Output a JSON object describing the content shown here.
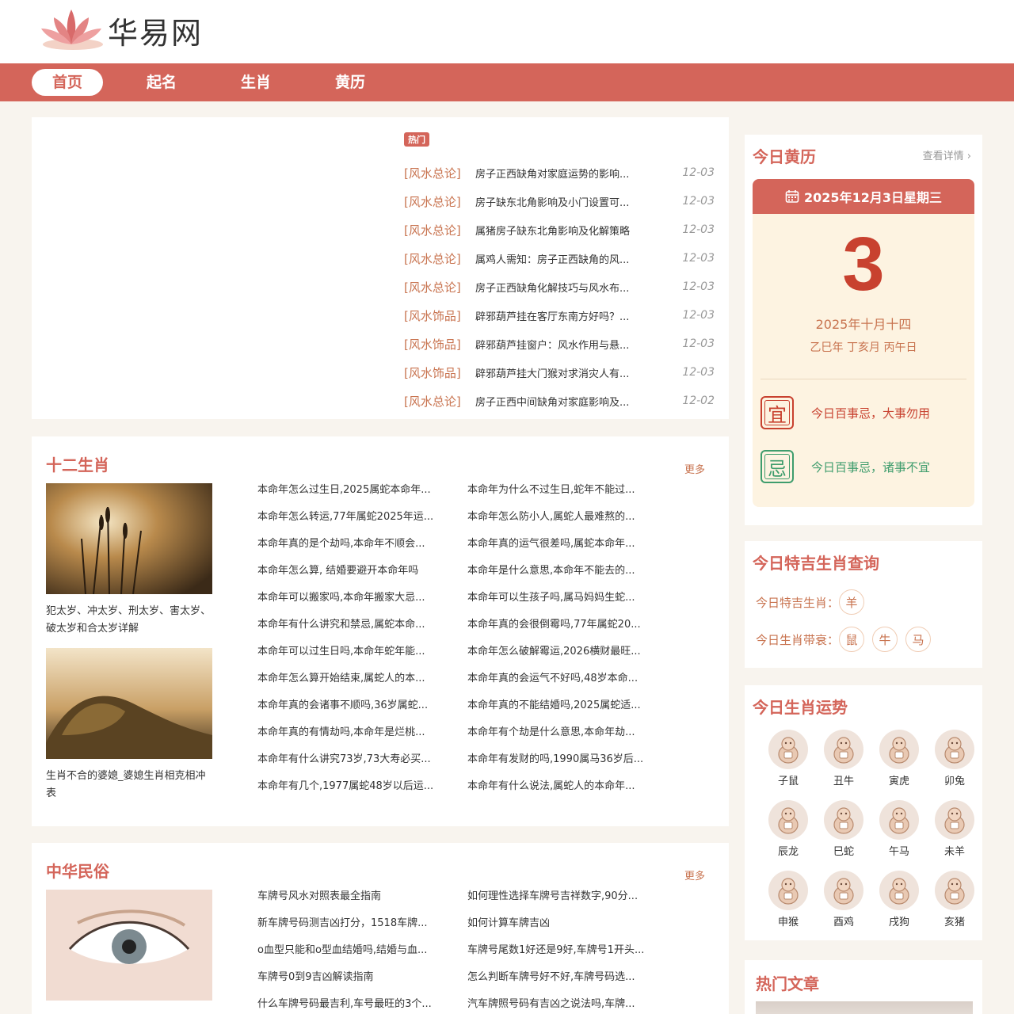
{
  "site": {
    "name": "华易网"
  },
  "nav": [
    "首页",
    "起名",
    "生肖",
    "黄历"
  ],
  "hot": {
    "tag": "热门",
    "items": [
      {
        "cat": "[风水总论]",
        "title": "房子正西缺角对家庭运势的影响...",
        "date": "12-03"
      },
      {
        "cat": "[风水总论]",
        "title": "房子缺东北角影响及小门设置可...",
        "date": "12-03"
      },
      {
        "cat": "[风水总论]",
        "title": "属猪房子缺东北角影响及化解策略",
        "date": "12-03"
      },
      {
        "cat": "[风水总论]",
        "title": "属鸡人需知：房子正西缺角的风...",
        "date": "12-03"
      },
      {
        "cat": "[风水总论]",
        "title": "房子正西缺角化解技巧与风水布...",
        "date": "12-03"
      },
      {
        "cat": "[风水饰品]",
        "title": "辟邪葫芦挂在客厅东南方好吗？...",
        "date": "12-03"
      },
      {
        "cat": "[风水饰品]",
        "title": "辟邪葫芦挂窗户：风水作用与悬...",
        "date": "12-03"
      },
      {
        "cat": "[风水饰品]",
        "title": "辟邪葫芦挂大门猴对求消灾人有...",
        "date": "12-03"
      },
      {
        "cat": "[风水总论]",
        "title": "房子正西中间缺角对家庭影响及...",
        "date": "12-02"
      }
    ]
  },
  "zodiac_section": {
    "title": "十二生肖",
    "more": "更多",
    "captions": [
      "犯太岁、冲太岁、刑太岁、害太岁、破太岁和合太岁详解",
      "生肖不合的婆媳_婆媳生肖相克相冲表"
    ],
    "col1": [
      "本命年怎么过生日,2025属蛇本命年...",
      "本命年怎么转运,77年属蛇2025年运...",
      "本命年真的是个劫吗,本命年不顺会...",
      "本命年怎么算, 结婚要避开本命年吗",
      "本命年可以搬家吗,本命年搬家大忌...",
      "本命年有什么讲究和禁忌,属蛇本命...",
      "本命年可以过生日吗,本命年蛇年能...",
      "本命年怎么算开始结束,属蛇人的本...",
      "本命年真的会诸事不顺吗,36岁属蛇...",
      "本命年真的有情劫吗,本命年是烂桃...",
      "本命年有什么讲究73岁,73大寿必买...",
      "本命年有几个,1977属蛇48岁以后运..."
    ],
    "col2": [
      "本命年为什么不过生日,蛇年不能过...",
      "本命年怎么防小人,属蛇人最难熬的...",
      "本命年真的运气很差吗,属蛇本命年...",
      "本命年是什么意思,本命年不能去的...",
      "本命年可以生孩子吗,属马妈妈生蛇...",
      "本命年真的会很倒霉吗,77年属蛇20...",
      "本命年怎么破解霉运,2026横财最旺...",
      "本命年真的会运气不好吗,48岁本命...",
      "本命年真的不能结婚吗,2025属蛇适...",
      "本命年有个劫是什么意思,本命年劫...",
      "本命年有发财的吗,1990属马36岁后...",
      "本命年有什么说法,属蛇人的本命年..."
    ]
  },
  "custom_section": {
    "title": "中华民俗",
    "more": "更多",
    "col1": [
      "车牌号风水对照表最全指南",
      "新车牌号码测吉凶打分，1518车牌...",
      "o血型只能和o型血结婚吗,结婚与血...",
      "车牌号0到9吉凶解读指南",
      "什么车牌号码最吉利,车号最旺的3个..."
    ],
    "col2": [
      "如何理性选择车牌号吉祥数字,90分...",
      "如何计算车牌吉凶",
      "车牌号尾数1好还是9好,车牌号1开头...",
      "怎么判断车牌号好不好,车牌号码选...",
      "汽车牌照号码有吉凶之说法吗,车牌..."
    ]
  },
  "calendar": {
    "title": "今日黄历",
    "more": "查看详情",
    "date": "2025年12月3日星期三",
    "day": "3",
    "lunar": "2025年十月十四",
    "ganzhi": "乙巳年 丁亥月 丙午日",
    "yi_label": "宜",
    "yi_text": "今日百事忌，大事勿用",
    "ji_label": "忌",
    "ji_text": "今日百事忌，诸事不宜",
    "colors": {
      "yi": "#c8412f",
      "ji": "#3f9d6d"
    }
  },
  "lucky": {
    "title": "今日特吉生肖查询",
    "best_label": "今日特吉生肖：",
    "best": [
      "羊"
    ],
    "bad_label": "今日生肖带衰：",
    "bad": [
      "鼠",
      "牛",
      "马"
    ]
  },
  "fortune": {
    "title": "今日生肖运势",
    "items": [
      "子鼠",
      "丑牛",
      "寅虎",
      "卯兔",
      "辰龙",
      "巳蛇",
      "午马",
      "未羊",
      "申猴",
      "酉鸡",
      "戌狗",
      "亥猪"
    ]
  },
  "hot_articles": {
    "title": "热门文章"
  }
}
